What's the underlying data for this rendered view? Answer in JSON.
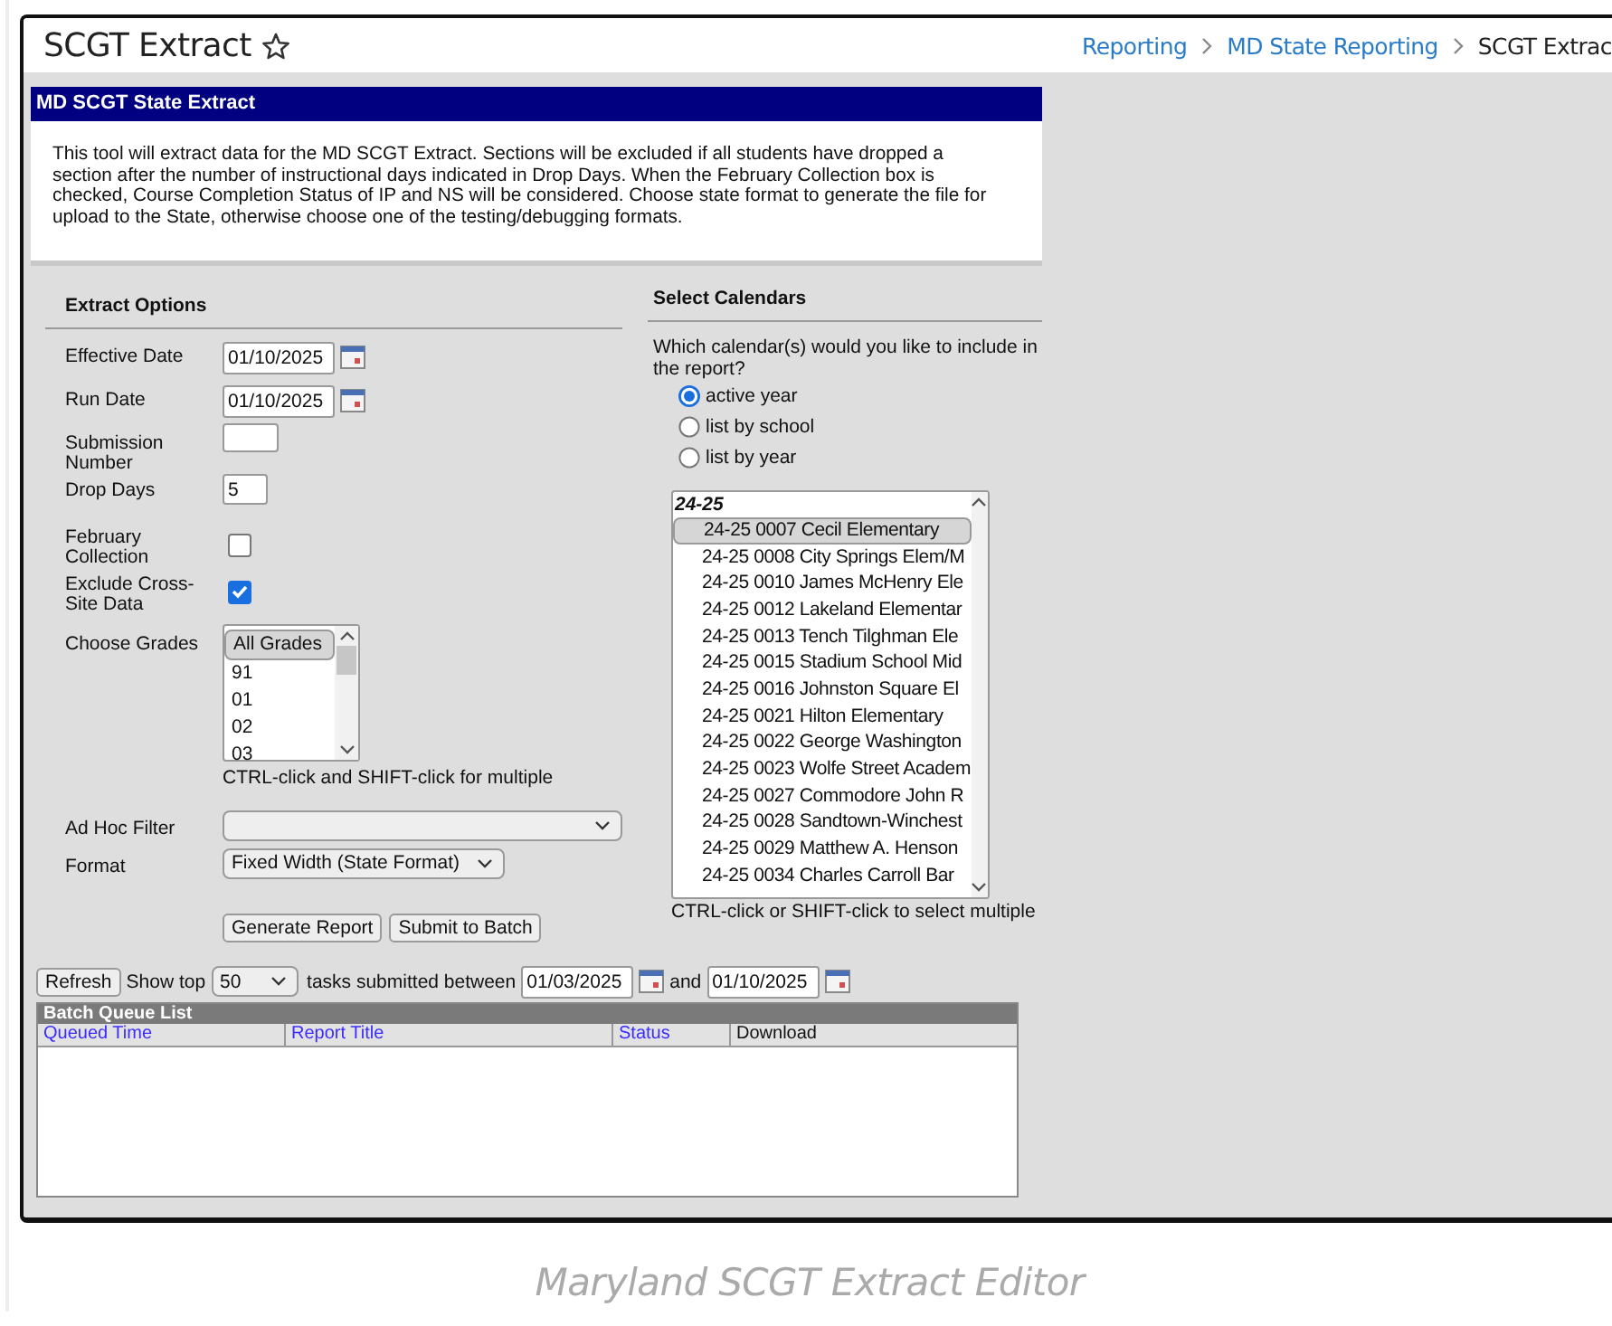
{
  "header": {
    "title": "SCGT Extract",
    "favorited": false,
    "breadcrumbs": [
      {
        "label": "Reporting",
        "current": false
      },
      {
        "label": "MD State Reporting",
        "current": false
      },
      {
        "label": "SCGT Extrac",
        "current": true
      }
    ]
  },
  "panel": {
    "title": "MD SCGT State Extract",
    "description": "This tool will extract data for the MD SCGT Extract. Sections will be excluded if all students have dropped a section after the number of instructional days indicated in Drop Days. When the February Collection box is checked, Course Completion Status of IP and NS will be considered. Choose state format to generate the file for upload to the State, otherwise choose one of the testing/debugging formats."
  },
  "extract_options": {
    "heading": "Extract Options",
    "fields": [
      {
        "kind": "date",
        "label": "Effective Date",
        "value": "01/10/2025"
      },
      {
        "kind": "date",
        "label": "Run Date",
        "value": "01/10/2025"
      },
      {
        "kind": "text",
        "label": "Submission Number"
      },
      {
        "kind": "number",
        "label": "Drop Days",
        "value": "5"
      },
      {
        "kind": "checkbox",
        "label": "February Collection",
        "checked": false
      },
      {
        "kind": "checkbox",
        "label": "Exclude Cross-Site Data",
        "checked": true
      },
      {
        "kind": "listbox",
        "label": "Choose Grades",
        "items": [
          {
            "label": "All Grades",
            "selected": true
          },
          {
            "label": "91",
            "selected": false
          },
          {
            "label": "01",
            "selected": false
          },
          {
            "label": "02",
            "selected": false
          },
          {
            "label": "03",
            "selected": false
          }
        ],
        "hint": "CTRL-click and SHIFT-click for multiple"
      },
      {
        "kind": "select",
        "label": "Ad Hoc Filter"
      },
      {
        "kind": "select",
        "label": "Format",
        "value": "Fixed Width (State Format)"
      }
    ],
    "buttons": [
      "Generate Report",
      "Submit to Batch"
    ]
  },
  "calendars": {
    "heading": "Select Calendars",
    "question": "Which calendar(s) would you like to include in the report?",
    "options": [
      {
        "label": "active year",
        "selected": true
      },
      {
        "label": "list by school",
        "selected": false
      },
      {
        "label": "list by year",
        "selected": false
      }
    ],
    "group": "24-25",
    "items": [
      {
        "label": "24-25 0007 Cecil Elementary",
        "selected": true
      },
      {
        "label": "24-25 0008 City Springs Elem/M",
        "selected": false
      },
      {
        "label": "24-25 0010 James McHenry Ele",
        "selected": false
      },
      {
        "label": "24-25 0012 Lakeland Elementar",
        "selected": false
      },
      {
        "label": "24-25 0013 Tench Tilghman Ele",
        "selected": false
      },
      {
        "label": "24-25 0015 Stadium School Mid",
        "selected": false
      },
      {
        "label": "24-25 0016 Johnston Square El",
        "selected": false
      },
      {
        "label": "24-25 0021 Hilton Elementary",
        "selected": false
      },
      {
        "label": "24-25 0022 George Washington",
        "selected": false
      },
      {
        "label": "24-25 0023 Wolfe Street Academ",
        "selected": false
      },
      {
        "label": "24-25 0027 Commodore John R",
        "selected": false
      },
      {
        "label": "24-25 0028 Sandtown-Winchest",
        "selected": false
      },
      {
        "label": "24-25 0029 Matthew A. Henson",
        "selected": false
      },
      {
        "label": "24-25 0034 Charles Carroll Bar",
        "selected": false
      }
    ],
    "hint": "CTRL-click or SHIFT-click to select multiple"
  },
  "batch": {
    "refresh": "Refresh",
    "show_top": "Show top",
    "count": "50",
    "between": "tasks submitted between",
    "start": "01/03/2025",
    "and": "and",
    "end": "01/10/2025",
    "title": "Batch Queue List",
    "columns": [
      {
        "label": "Queued Time",
        "sortable": true
      },
      {
        "label": "Report Title",
        "sortable": true
      },
      {
        "label": "Status",
        "sortable": true
      },
      {
        "label": "Download",
        "sortable": false
      }
    ]
  },
  "caption": "Maryland SCGT Extract Editor"
}
